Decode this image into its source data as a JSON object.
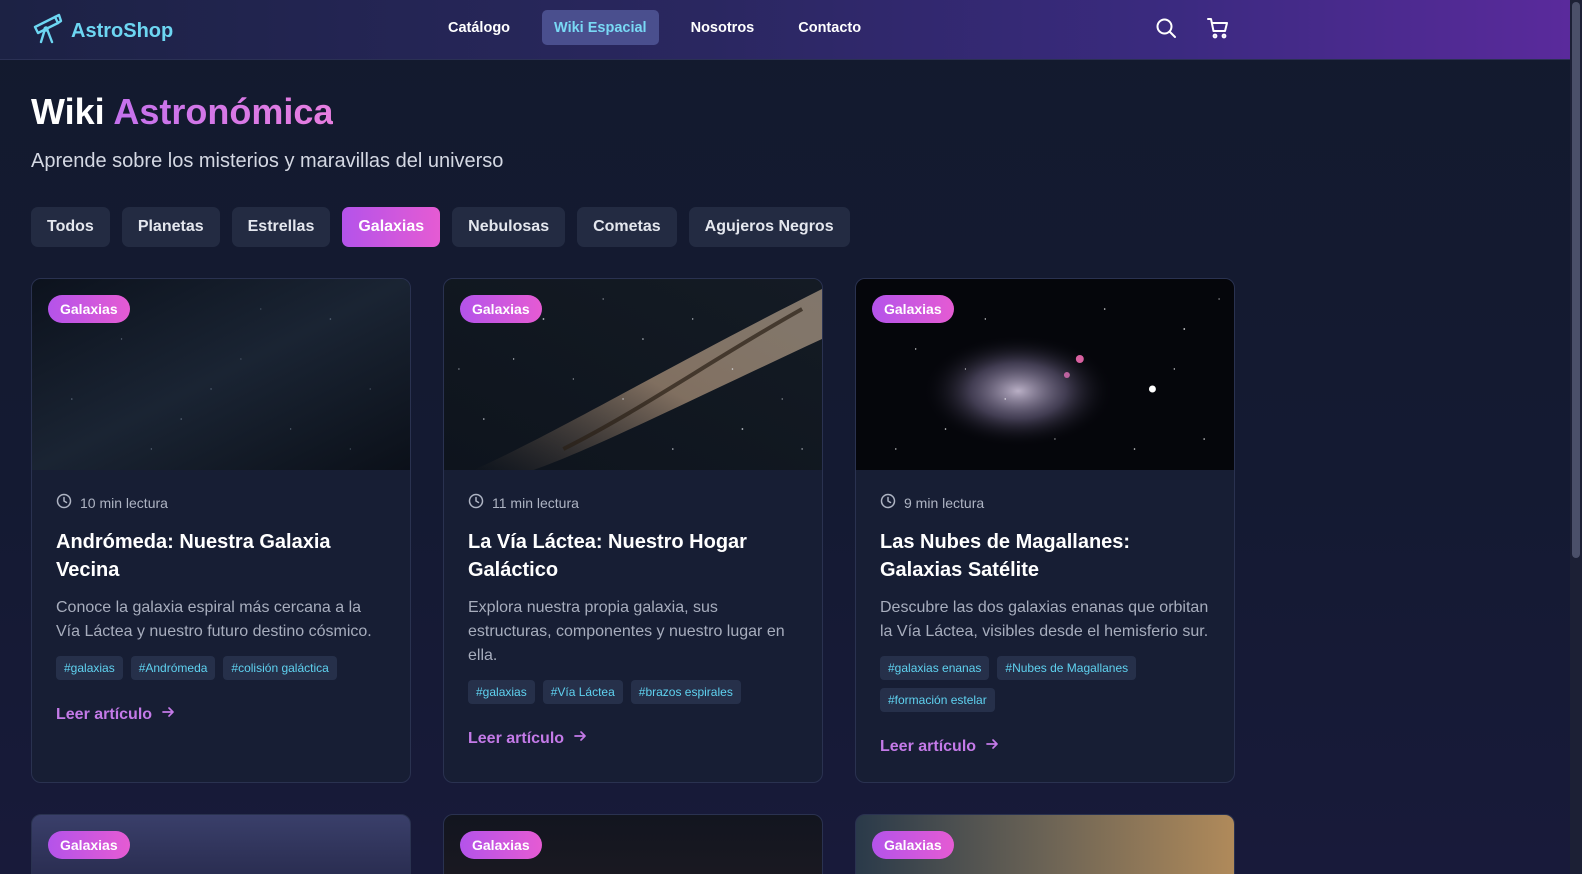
{
  "header": {
    "brand": "AstroShop",
    "nav": [
      {
        "label": "Catálogo",
        "active": false
      },
      {
        "label": "Wiki Espacial",
        "active": true
      },
      {
        "label": "Nosotros",
        "active": false
      },
      {
        "label": "Contacto",
        "active": false
      }
    ],
    "icons": [
      "search-icon",
      "cart-icon"
    ]
  },
  "hero": {
    "title_plain": "Wiki",
    "title_accent": "Astronómica",
    "subtitle": "Aprende sobre los misterios y maravillas del universo"
  },
  "filters": [
    {
      "label": "Todos",
      "active": false
    },
    {
      "label": "Planetas",
      "active": false
    },
    {
      "label": "Estrellas",
      "active": false
    },
    {
      "label": "Galaxias",
      "active": true
    },
    {
      "label": "Nebulosas",
      "active": false
    },
    {
      "label": "Cometas",
      "active": false
    },
    {
      "label": "Agujeros Negros",
      "active": false
    }
  ],
  "cards": [
    {
      "badge": "Galaxias",
      "read_time": "10 min lectura",
      "title": "Andrómeda: Nuestra Galaxia Vecina",
      "description": "Conoce la galaxia espiral más cercana a la Vía Láctea y nuestro futuro destino cósmico.",
      "tags": [
        "#galaxias",
        "#Andrómeda",
        "#colisión galáctica"
      ],
      "cta": "Leer artículo"
    },
    {
      "badge": "Galaxias",
      "read_time": "11 min lectura",
      "title": "La Vía Láctea: Nuestro Hogar Galáctico",
      "description": "Explora nuestra propia galaxia, sus estructuras, componentes y nuestro lugar en ella.",
      "tags": [
        "#galaxias",
        "#Vía Láctea",
        "#brazos espirales"
      ],
      "cta": "Leer artículo"
    },
    {
      "badge": "Galaxias",
      "read_time": "9 min lectura",
      "title": "Las Nubes de Magallanes: Galaxias Satélite",
      "description": "Descubre las dos galaxias enanas que orbitan la Vía Láctea, visibles desde el hemisferio sur.",
      "tags": [
        "#galaxias enanas",
        "#Nubes de Magallanes",
        "#formación estelar"
      ],
      "cta": "Leer artículo"
    }
  ],
  "next_row_badges": [
    "Galaxias",
    "Galaxias",
    "Galaxias"
  ],
  "colors": {
    "accent_gradient_start": "#b453ea",
    "accent_gradient_end": "#e55bd3",
    "tag_text": "#5fd2f0",
    "link": "#c47ae8",
    "brand": "#6dd6f2"
  }
}
